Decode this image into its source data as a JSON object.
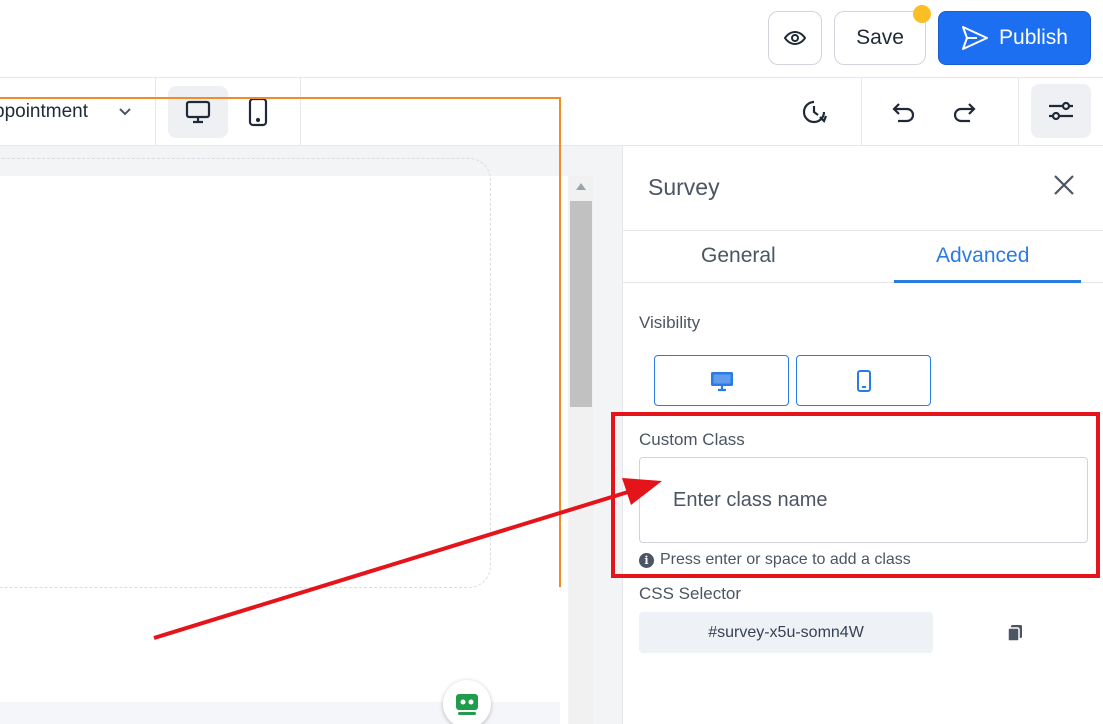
{
  "header": {
    "save_label": "Save",
    "publish_label": "Publish",
    "unsaved_dot_color": "#fbbf24",
    "publish_color": "#1d6ff2"
  },
  "toolbar": {
    "page_select_value": "ppointment",
    "active_device": "desktop"
  },
  "panel": {
    "title": "Survey",
    "tabs": [
      {
        "label": "General",
        "active": false
      },
      {
        "label": "Advanced",
        "active": true
      }
    ],
    "visibility_label": "Visibility",
    "visibility_options": [
      "desktop-icon",
      "mobile-icon"
    ],
    "custom_class": {
      "label": "Custom Class",
      "placeholder": "Enter class name",
      "value": "",
      "hint": "Press enter or space to add a class"
    },
    "css_selector": {
      "label": "CSS Selector",
      "value": "#survey-x5u-somn4W"
    }
  },
  "annotation": {
    "highlight_color": "#e5131a",
    "arrow_color": "#e5131a"
  }
}
